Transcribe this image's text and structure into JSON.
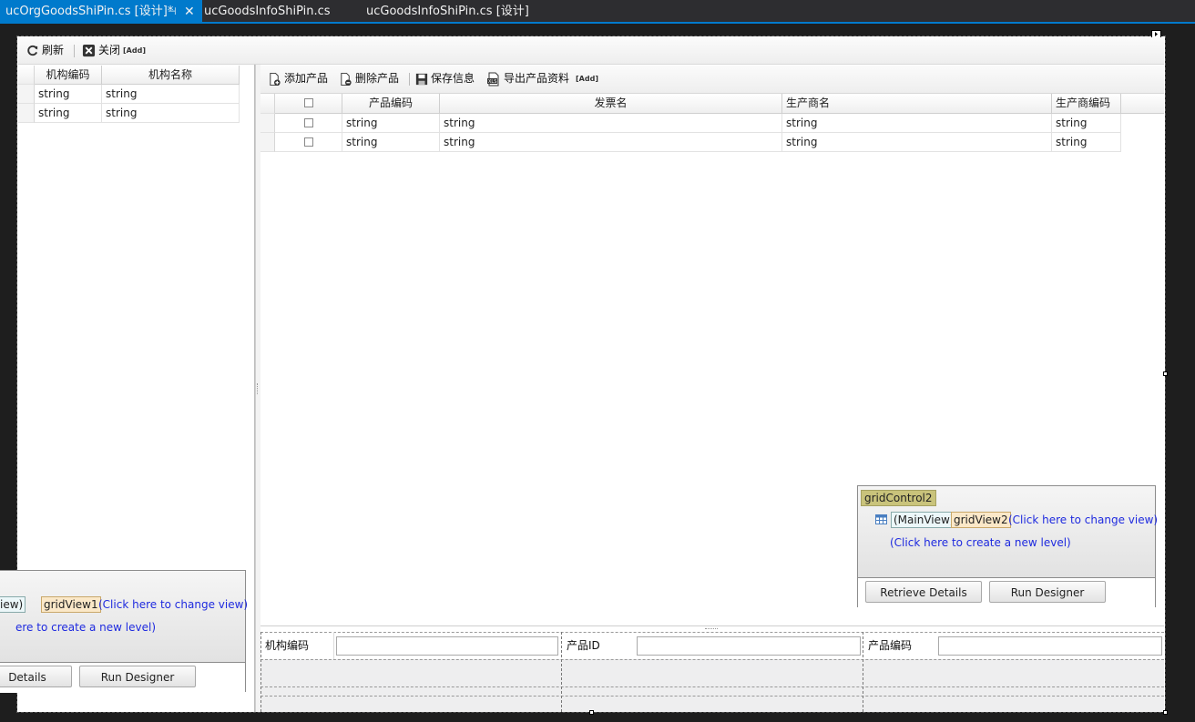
{
  "tabs": [
    {
      "label": "ucOrgGoodsShiPin.cs [设计]*",
      "pin_glyph": "⊣",
      "close_glyph": "✕"
    },
    {
      "label": "ucGoodsInfoShiPin.cs"
    },
    {
      "label": "ucGoodsInfoShiPin.cs [设计]"
    }
  ],
  "toolbar1": {
    "refresh": "刷新",
    "close": "关闭",
    "add": "[Add]"
  },
  "left_grid": {
    "columns": [
      "机构编码",
      "机构名称"
    ],
    "rows": [
      [
        "string",
        "string"
      ],
      [
        "string",
        "string"
      ]
    ]
  },
  "toolbar2": {
    "add_product": "添加产品",
    "delete_product": "删除产品",
    "save_info": "保存信息",
    "export_product": "导出产品资料",
    "add": "[Add]"
  },
  "right_grid": {
    "columns": [
      "产品编码",
      "发票名",
      "生产商名",
      "生产商编码"
    ],
    "rows": [
      [
        "string",
        "string",
        "string",
        "string"
      ],
      [
        "string",
        "string",
        "string",
        "string"
      ]
    ]
  },
  "designer_panel_right": {
    "control": "gridControl2",
    "main_view": "(MainView)",
    "view_name": "gridView2",
    "change_view": "(Click here to change view)",
    "create_level": "(Click here to create a new level)",
    "retrieve": "Retrieve Details",
    "run_designer": "Run Designer"
  },
  "designer_panel_left": {
    "main_view": "iew)",
    "view_name": "gridView1",
    "change_view": "(Click here to change view)",
    "create_level": "ere to create a new level)",
    "retrieve": "Details",
    "run_designer": "Run Designer"
  },
  "bottom_layout": {
    "labels": [
      "机构编码",
      "产品ID",
      "产品编码"
    ]
  },
  "colors": {
    "accent": "#007acc",
    "link": "#1e2adf",
    "olive_tag": "#c9c37b"
  }
}
